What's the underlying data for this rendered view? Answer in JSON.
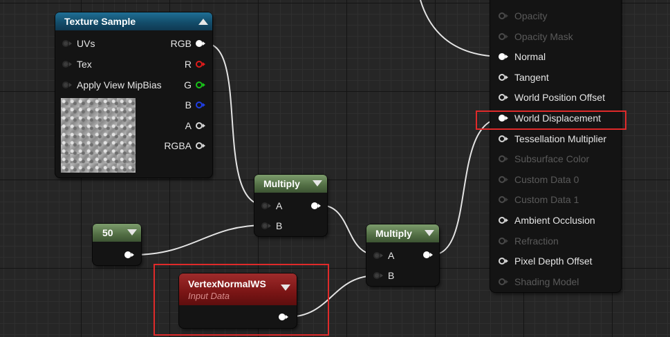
{
  "texture_sample": {
    "title": "Texture Sample",
    "inputs": [
      "UVs",
      "Tex",
      "Apply View MipBias"
    ],
    "outputs": [
      "RGB",
      "R",
      "G",
      "B",
      "A",
      "RGBA"
    ]
  },
  "constant_node": {
    "value": "50"
  },
  "multiply_1": {
    "title": "Multiply",
    "input_a": "A",
    "input_b": "B"
  },
  "multiply_2": {
    "title": "Multiply",
    "input_a": "A",
    "input_b": "B"
  },
  "vertex_normal": {
    "title": "VertexNormalWS",
    "subtitle": "Input Data"
  },
  "material_output": {
    "pins": [
      "Opacity",
      "Opacity Mask",
      "Normal",
      "Tangent",
      "World Position Offset",
      "World Displacement",
      "Tessellation Multiplier",
      "Subsurface Color",
      "Custom Data 0",
      "Custom Data 1",
      "Ambient Occlusion",
      "Refraction",
      "Pixel Depth Offset",
      "Shading Model"
    ],
    "enabled": [
      false,
      false,
      true,
      true,
      true,
      true,
      true,
      false,
      false,
      false,
      true,
      false,
      true,
      false
    ],
    "connected": [
      false,
      false,
      true,
      false,
      false,
      true,
      false,
      false,
      false,
      false,
      false,
      false,
      false,
      false
    ]
  },
  "colors": {
    "highlight": "#e02a2a",
    "texture_header": "#134d6b",
    "multiply_header": "#526e44",
    "vertex_header": "#7a1515",
    "pin_r": "#e01b1b",
    "pin_g": "#18c418",
    "pin_b": "#1f3ee6"
  }
}
